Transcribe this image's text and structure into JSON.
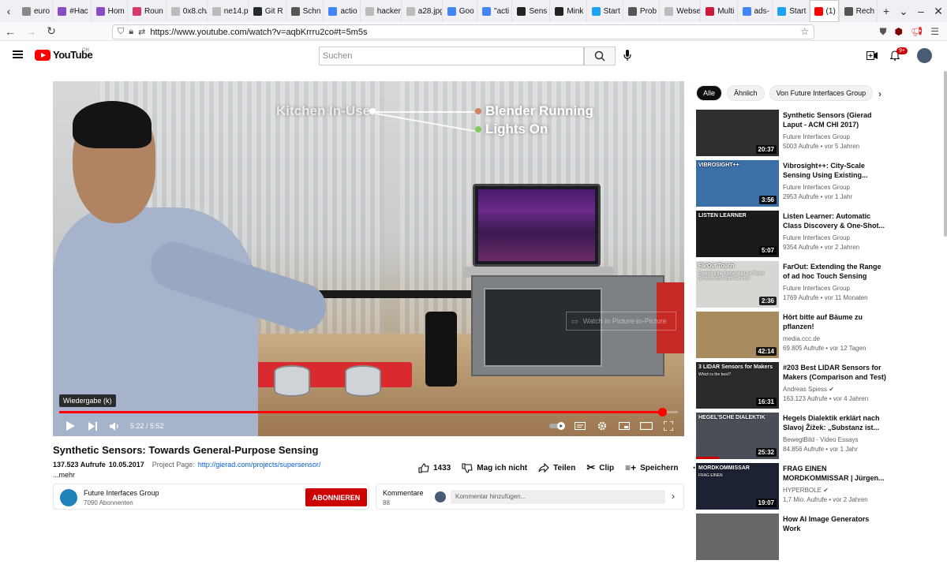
{
  "browser": {
    "tabs": [
      {
        "label": "euro",
        "color": "#888888"
      },
      {
        "label": "#Hac",
        "color": "#8a4cc4"
      },
      {
        "label": "Hom",
        "color": "#8a4cc4"
      },
      {
        "label": "Roun",
        "color": "#d83a6a"
      },
      {
        "label": "0x8.ch/•",
        "color": "#bbbbbb"
      },
      {
        "label": "ne14.pn",
        "color": "#bbbbbb"
      },
      {
        "label": "Git R",
        "color": "#24292e"
      },
      {
        "label": "Schn",
        "color": "#555555"
      },
      {
        "label": "actio",
        "color": "#4285f4"
      },
      {
        "label": "hackers",
        "color": "#bbbbbb"
      },
      {
        "label": "a28.jpg",
        "color": "#bbbbbb"
      },
      {
        "label": "Goo",
        "color": "#4285f4"
      },
      {
        "label": "\"acti",
        "color": "#4285f4"
      },
      {
        "label": "Sens",
        "color": "#222222"
      },
      {
        "label": "Mink",
        "color": "#222222"
      },
      {
        "label": "Start",
        "color": "#1da1f2"
      },
      {
        "label": "Prob",
        "color": "#555555"
      },
      {
        "label": "Webseit",
        "color": "#bbbbbb"
      },
      {
        "label": "Multi",
        "color": "#cc1b3a"
      },
      {
        "label": "ads-",
        "color": "#4285f4"
      },
      {
        "label": "Start",
        "color": "#1da1f2"
      },
      {
        "label": "(1)",
        "color": "#ff0000",
        "active": true
      },
      {
        "label": "Rech",
        "color": "#555555"
      }
    ],
    "url": "https://www.youtube.com/watch?v=aqbKrrru2co#t=5m5s"
  },
  "yt": {
    "logo_text": "YouTube",
    "country": "CH",
    "search_placeholder": "Suchen",
    "notif_count": "9+"
  },
  "player": {
    "overlay": {
      "left": "Kitchen In-Use",
      "right1": "Blender Running",
      "right2": "Lights On"
    },
    "pip": "Watch in Picture-in-Picture",
    "tooltip": "Wiedergabe (k)",
    "time": "5:22 / 5:52",
    "progress": 0.9744
  },
  "video": {
    "title": "Synthetic Sensors: Towards General-Purpose Sensing",
    "views": "137.523 Aufrufe",
    "date": "10.05.2017",
    "project_label": "Project Page:",
    "project_link": "http://gierad.com/projects/supersensor/",
    "more": "...mehr",
    "likes": "1433",
    "dislike": "Mag ich nicht",
    "share": "Teilen",
    "clip": "Clip",
    "save": "Speichern"
  },
  "channel": {
    "name": "Future Interfaces Group",
    "subs": "7090 Abonnenten",
    "subscribe": "ABONNIEREN"
  },
  "comments": {
    "label": "Kommentare",
    "count": "88",
    "placeholder": "Kommentar hinzufügen..."
  },
  "chips": [
    "Alle",
    "Ähnlich",
    "Von Future Interfaces Group"
  ],
  "recommendations": [
    {
      "title": "Synthetic Sensors (Gierad Laput - ACM CHI 2017)",
      "channel": "Future Interfaces Group",
      "meta": "5003 Aufrufe • vor 5 Jahren",
      "duration": "20:37",
      "bg": "#2f2f2f"
    },
    {
      "title": "Vibrosight++: City-Scale Sensing Using Existing...",
      "channel": "Future Interfaces Group",
      "meta": "2953 Aufrufe • vor 1 Jahr",
      "duration": "3:56",
      "bg": "#3a6fa8",
      "thumb_label": "VIBROSIGHT++"
    },
    {
      "title": "Listen Learner: Automatic Class Discovery & One-Shot...",
      "channel": "Future Interfaces Group",
      "meta": "9354 Aufrufe • vor 2 Jahren",
      "duration": "5:07",
      "bg": "#1b1b1b",
      "thumb_label": "LISTEN LEARNER"
    },
    {
      "title": "FarOut: Extending the Range of ad hoc Touch Sensing with...",
      "channel": "Future Interfaces Group",
      "meta": "1769 Aufrufe • vor 11 Monaten",
      "duration": "2:36",
      "bg": "#d8d6d2",
      "thumb_label": "FarOut Touch",
      "thumb_sub": "Extending the Range of ad hoc Touch Sensing with Depth Cameras"
    },
    {
      "title": "Hört bitte auf Bäume zu pflanzen!",
      "channel": "media.ccc.de",
      "meta": "69.805 Aufrufe • vor 12 Tagen",
      "duration": "42:14",
      "bg": "#a98b60"
    },
    {
      "title": "#203 Best LIDAR Sensors for Makers (Comparison and Test)",
      "channel": "Andreas Spiess",
      "meta": "163.123 Aufrufe • vor 4 Jahren",
      "duration": "16:31",
      "bg": "#2a2a2a",
      "verified": true,
      "thumb_label": "3 LIDAR Sensors for Makers",
      "thumb_sub": "Which is the best?"
    },
    {
      "title": "Hegels Dialektik erklärt nach Slavoj Žižek: „Substanz ist...",
      "channel": "BewegtBild - Video Essays",
      "meta": "84.856 Aufrufe • vor 1 Jahr",
      "duration": "25:32",
      "bg": "#4a4e57",
      "watched": 0.28,
      "thumb_label": "HEGEL'SCHE DIALEKTIK"
    },
    {
      "title": "FRAG EINEN MORDKOMMISSAR | Jürgen...",
      "channel": "HYPERBOLE",
      "meta": "1,7 Mio. Aufrufe • vor 2 Jahren",
      "duration": "19:07",
      "bg": "#1c2233",
      "verified": true,
      "thumb_label": "MORDKOMMISSAR",
      "thumb_sub": "FRAG EINEN"
    },
    {
      "title": "How AI Image Generators Work",
      "channel": "",
      "meta": "",
      "duration": "",
      "bg": "#666666"
    }
  ]
}
